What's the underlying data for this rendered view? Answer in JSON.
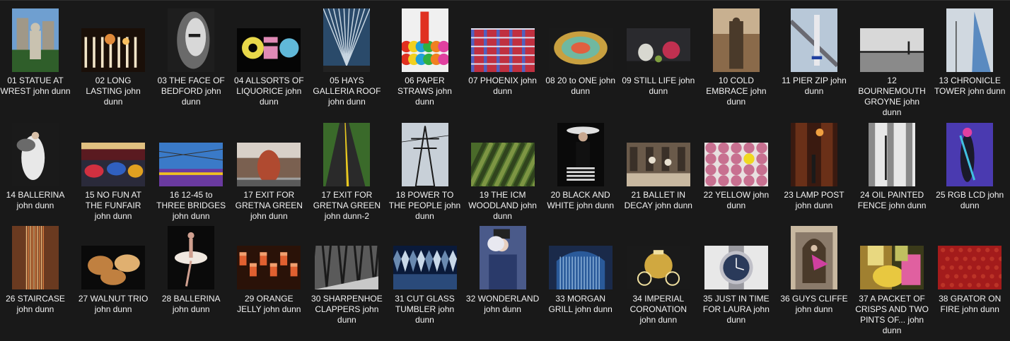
{
  "window": {
    "background": "#191919",
    "text_color": "#f2f2f2"
  },
  "files": [
    {
      "label": "01 STATUE AT WREST john dunn",
      "kind": "statue",
      "orient": "p",
      "colors": [
        "#6f9fd0",
        "#c9c2b0",
        "#2f5e2a"
      ]
    },
    {
      "label": "02 LONG LASTING john dunn",
      "kind": "matches",
      "orient": "l",
      "colors": [
        "#1a0f08",
        "#e08a3a",
        "#f2e5c8"
      ]
    },
    {
      "label": "03 THE FACE OF BEDFORD john dunn",
      "kind": "face",
      "orient": "p",
      "colors": [
        "#d8d8d8",
        "#6a6a6a",
        "#1e1e1e"
      ]
    },
    {
      "label": "04 ALLSORTS OF LIQUORICE john dunn",
      "kind": "sweets",
      "orient": "l",
      "colors": [
        "#050505",
        "#e8d84a",
        "#e08ab6"
      ]
    },
    {
      "label": "05 HAYS GALLERIA ROOF john dunn",
      "kind": "arch",
      "orient": "p",
      "colors": [
        "#2a4a6a",
        "#c8d6e2",
        "#4e6e8e"
      ]
    },
    {
      "label": "06 PAPER STRAWS john dunn",
      "kind": "straws",
      "orient": "p",
      "colors": [
        "#e03020",
        "#f2d020",
        "#22a0d8"
      ]
    },
    {
      "label": "07 PHOENIX john dunn",
      "kind": "wool",
      "orient": "l",
      "colors": [
        "#c03040",
        "#5060c0",
        "#e0e0f0"
      ]
    },
    {
      "label": "08 20 to ONE john dunn",
      "kind": "coin",
      "orient": "l",
      "colors": [
        "#1a1a1a",
        "#c8a040",
        "#70b8a0"
      ]
    },
    {
      "label": "09 STILL LIFE john dunn",
      "kind": "stilllife",
      "orient": "l",
      "colors": [
        "#2a2a2e",
        "#c03050",
        "#d8d8d0"
      ]
    },
    {
      "label": "10 COLD EMBRACE john dunn",
      "kind": "station",
      "orient": "p",
      "colors": [
        "#8a6a4a",
        "#4a3a2a",
        "#c8b090"
      ]
    },
    {
      "label": "11 PIER ZIP john dunn",
      "kind": "pier",
      "orient": "p",
      "colors": [
        "#b8c8d8",
        "#6a6a72",
        "#e8e8ec"
      ]
    },
    {
      "label": "12 BOURNEMOUTH GROYNE john dunn",
      "kind": "groyne",
      "orient": "l",
      "colors": [
        "#d8d8d8",
        "#8a8a8a",
        "#1e1e1e"
      ]
    },
    {
      "label": "13 CHRONICLE TOWER john dunn",
      "kind": "tower",
      "orient": "p",
      "colors": [
        "#5a8ac0",
        "#a0c0e0",
        "#d0d8e0"
      ]
    },
    {
      "label": "14 BALLERINA john dunn",
      "kind": "ballerina_dark",
      "orient": "p",
      "colors": [
        "#1a1a1a",
        "#e8e8e8",
        "#6a6a6a"
      ]
    },
    {
      "label": "15 NO FUN AT THE FUNFAIR john dunn",
      "kind": "funfair",
      "orient": "l",
      "colors": [
        "#5a1a20",
        "#d03040",
        "#3060c0"
      ]
    },
    {
      "label": "16 12-45 to THREE BRIDGES john dunn",
      "kind": "train",
      "orient": "l",
      "colors": [
        "#3a7ac8",
        "#6a3aa0",
        "#e8e8f0"
      ]
    },
    {
      "label": "17 EXIT FOR GRETNA GREEN john dunn",
      "kind": "sculpture",
      "orient": "l",
      "colors": [
        "#a0a0a0",
        "#b04a30",
        "#4a4a4a"
      ]
    },
    {
      "label": "17 EXIT FOR GRETNA GREEN john dunn-2",
      "kind": "road",
      "orient": "p",
      "colors": [
        "#3a6a2a",
        "#2a2a2a",
        "#e8c820"
      ]
    },
    {
      "label": "18 POWER TO THE PEOPLE john dunn",
      "kind": "pylon",
      "orient": "p",
      "colors": [
        "#c8d0d8",
        "#6a7a8a",
        "#1a1a1a"
      ]
    },
    {
      "label": "19 THE ICM WOODLAND john dunn",
      "kind": "blur",
      "orient": "l",
      "colors": [
        "#4a6a2a",
        "#8aa04a",
        "#2a3a1a"
      ]
    },
    {
      "label": "20 BLACK AND WHITE john dunn",
      "kind": "hatwoman",
      "orient": "p",
      "colors": [
        "#0a0a0a",
        "#e0e0e0",
        "#707070"
      ]
    },
    {
      "label": "21 BALLET IN DECAY john dunn",
      "kind": "decay",
      "orient": "l",
      "colors": [
        "#6a5a4a",
        "#c8b8a0",
        "#e8e0d0"
      ]
    },
    {
      "label": "22 YELLOW john dunn",
      "kind": "jelly",
      "orient": "l",
      "colors": [
        "#9a4a6a",
        "#c87090",
        "#f0d820"
      ]
    },
    {
      "label": "23 LAMP POST john dunn",
      "kind": "lamppost",
      "orient": "p",
      "colors": [
        "#3a1a10",
        "#a04a20",
        "#f0a040"
      ]
    },
    {
      "label": "24 OIL PAINTED FENCE john dunn",
      "kind": "fence",
      "orient": "p",
      "colors": [
        "#e8e8e8",
        "#8a8a8a",
        "#1a1a1a"
      ]
    },
    {
      "label": "25 RGB LCD john dunn",
      "kind": "rgb",
      "orient": "p",
      "colors": [
        "#4a3ab0",
        "#e040a0",
        "#40c0e0"
      ]
    },
    {
      "label": "26 STAIRCASE john dunn",
      "kind": "staircase",
      "orient": "p",
      "colors": [
        "#e08040",
        "#6a3a20",
        "#f0c080"
      ]
    },
    {
      "label": "27 WALNUT TRIO john dunn",
      "kind": "walnut",
      "orient": "l",
      "colors": [
        "#0a0a0a",
        "#c08040",
        "#e0b070"
      ]
    },
    {
      "label": "28 BALLERINA john dunn",
      "kind": "ballerina2",
      "orient": "p",
      "colors": [
        "#0a0a0a",
        "#f0e8e0",
        "#d0a090"
      ]
    },
    {
      "label": "29 ORANGE JELLY john dunn",
      "kind": "glasses",
      "orient": "l",
      "colors": [
        "#e06030",
        "#f0a070",
        "#3a1a10"
      ]
    },
    {
      "label": "30 SHARPENHOE CLAPPERS john dunn",
      "kind": "forest",
      "orient": "l",
      "colors": [
        "#c8c8c8",
        "#5a5a5a",
        "#1a1a1a"
      ]
    },
    {
      "label": "31 CUT GLASS TUMBLER john dunn",
      "kind": "cutglass",
      "orient": "l",
      "colors": [
        "#2a4a7a",
        "#c8d8e8",
        "#6a8ab0"
      ]
    },
    {
      "label": "32 WONDERLAND john dunn",
      "kind": "wonderland",
      "orient": "p",
      "colors": [
        "#2a3a6a",
        "#e8e8f0",
        "#6a8ac8"
      ]
    },
    {
      "label": "33 MORGAN GRILL john dunn",
      "kind": "grill",
      "orient": "l",
      "colors": [
        "#2a5a9a",
        "#8ab0d8",
        "#1a2a4a"
      ]
    },
    {
      "label": "34 IMPERIAL CORONATION john dunn",
      "kind": "carriage",
      "orient": "l",
      "colors": [
        "#1a1a1a",
        "#d0a840",
        "#f0e0a0"
      ]
    },
    {
      "label": "35 JUST IN TIME FOR LAURA john dunn",
      "kind": "watch",
      "orient": "l",
      "colors": [
        "#e8e8e8",
        "#2a3a5a",
        "#9a9aa0"
      ]
    },
    {
      "label": "36 GUYS CLIFFE john dunn",
      "kind": "guys",
      "orient": "p",
      "colors": [
        "#c8b8a0",
        "#4a3a2a",
        "#d040a0"
      ]
    },
    {
      "label": "37 A PACKET OF CRISPS AND TWO PINTS OF... john dunn",
      "kind": "crisps",
      "orient": "l",
      "colors": [
        "#3a3a1a",
        "#e8c840",
        "#e060a0"
      ]
    },
    {
      "label": "38 GRATOR ON FIRE john dunn",
      "kind": "grator",
      "orient": "l",
      "colors": [
        "#1a0a0a",
        "#d02020",
        "#602020"
      ]
    }
  ]
}
